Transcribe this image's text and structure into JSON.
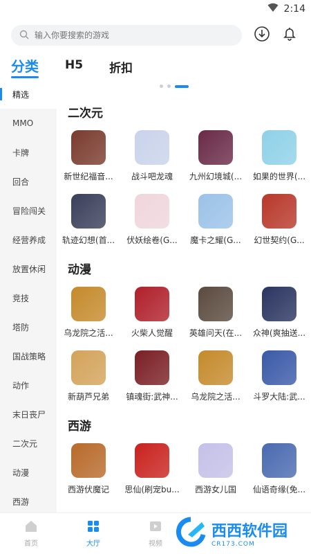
{
  "status_bar": {
    "time": "2:14",
    "icons": [
      "wifi-icon",
      "battery-icon"
    ]
  },
  "search": {
    "placeholder": "输入你要搜索的游戏",
    "icon": "search-icon"
  },
  "header_actions": {
    "download_icon": "download-icon",
    "bell_icon": "bell-icon"
  },
  "top_tabs": [
    {
      "label": "分类",
      "active": true
    },
    {
      "label": "H5",
      "active": false
    },
    {
      "label": "折扣",
      "active": false
    }
  ],
  "sidebar": {
    "items": [
      {
        "label": "精选",
        "active": true
      },
      {
        "label": "MMO"
      },
      {
        "label": "卡牌"
      },
      {
        "label": "回合"
      },
      {
        "label": "冒险闯关"
      },
      {
        "label": "经营养成"
      },
      {
        "label": "放置休闲"
      },
      {
        "label": "竞技"
      },
      {
        "label": "塔防"
      },
      {
        "label": "国战策略"
      },
      {
        "label": "动作"
      },
      {
        "label": "末日丧尸"
      },
      {
        "label": "二次元"
      },
      {
        "label": "动漫"
      },
      {
        "label": "西游"
      }
    ]
  },
  "sections": [
    {
      "title": "二次元",
      "games": [
        {
          "name": "新世纪福音...",
          "color": "#7a3b2e"
        },
        {
          "name": "战斗吧龙魂",
          "color": "#c9d3ea"
        },
        {
          "name": "九州幻境城(...",
          "color": "#6a2a48"
        },
        {
          "name": "如果的世界(...",
          "color": "#8fd1e8"
        },
        {
          "name": "轨迹幻想(首...",
          "color": "#3a3f5a"
        },
        {
          "name": "伏妖绘卷(G...",
          "color": "#efd6dc"
        },
        {
          "name": "魔卡之耀(G...",
          "color": "#9bc2e8"
        },
        {
          "name": "幻世契约(G...",
          "color": "#b8382a"
        }
      ]
    },
    {
      "title": "动漫",
      "games": [
        {
          "name": "乌龙院之活...",
          "color": "#c58a2c"
        },
        {
          "name": "火柴人觉醒",
          "color": "#b0202a"
        },
        {
          "name": "英雄问天(在...",
          "color": "#5b4a3e"
        },
        {
          "name": "众神(爽抽送...",
          "color": "#2a3560"
        },
        {
          "name": "新葫芦兄弟",
          "color": "#d3a35a"
        },
        {
          "name": "镇魂街:武神...",
          "color": "#7a1f24"
        },
        {
          "name": "乌龙院之活...",
          "color": "#c58a2c"
        },
        {
          "name": "斗罗大陆:武...",
          "color": "#3a5aa8"
        }
      ]
    },
    {
      "title": "西游",
      "games": [
        {
          "name": "西游伏魔记",
          "color": "#b86a2a"
        },
        {
          "name": "思仙(刷宠bu...",
          "color": "#c9221e"
        },
        {
          "name": "西游女儿国",
          "color": "#c5c0e8"
        },
        {
          "name": "仙语奇缘(免...",
          "color": "#4a6ab0"
        }
      ]
    }
  ],
  "bottom_nav": [
    {
      "label": "首页",
      "icon": "home-icon",
      "active": false
    },
    {
      "label": "大厅",
      "icon": "grid-icon",
      "active": true
    },
    {
      "label": "视频",
      "icon": "video-icon",
      "active": false
    }
  ],
  "watermark": {
    "title": "西西软件园",
    "sub": "CR173.COM"
  },
  "colors": {
    "accent": "#1a8cf0",
    "sidebar_bg": "#f5f5f5"
  }
}
